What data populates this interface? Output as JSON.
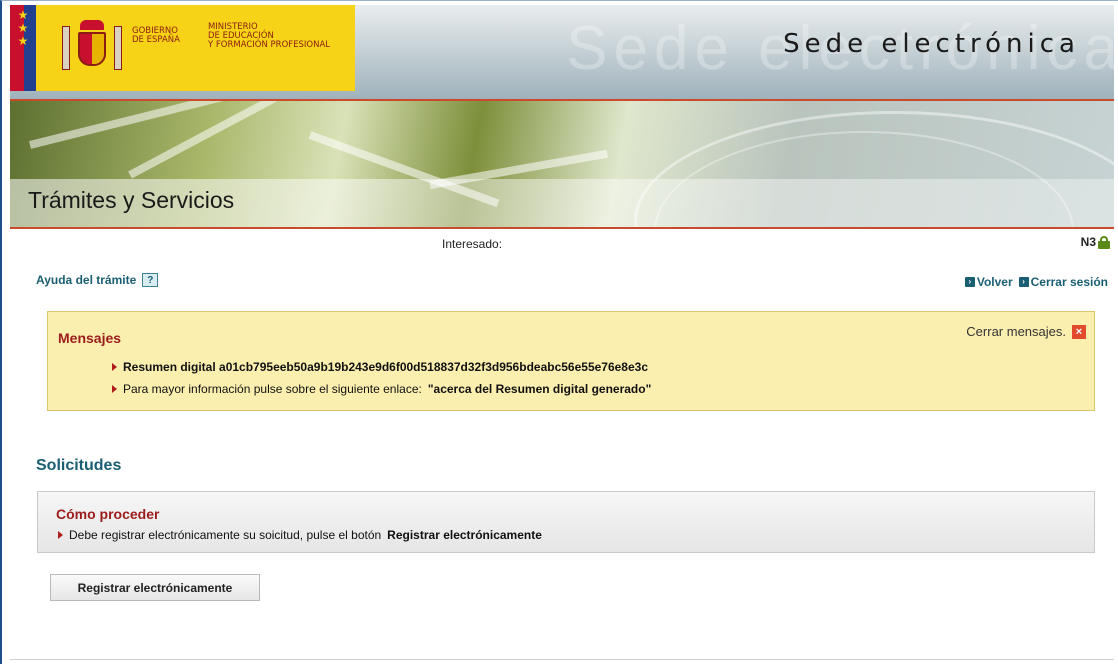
{
  "header": {
    "gov_line1": "GOBIERNO",
    "gov_line2": "DE ESPAÑA",
    "ministry_line1": "MINISTERIO",
    "ministry_line2": "DE EDUCACIÓN",
    "ministry_line3": "Y FORMACIÓN PROFESIONAL",
    "site_title": "Sede electrónica",
    "watermark": "Sede electrónica"
  },
  "banner": {
    "title": "Trámites y Servicios"
  },
  "user": {
    "interesado_label": "Interesado:",
    "level": "N3"
  },
  "links": {
    "help": "Ayuda del trámite",
    "back": "Volver",
    "logout": "Cerrar sesión"
  },
  "messages": {
    "title": "Mensajes",
    "close_label": "Cerrar mensajes.",
    "line1_prefix": "Resumen digital a01cb795eeb50a9b19b243e9d6f00d518837d32f3d956bdeabc56e55e76e8e3c",
    "line2_prefix": "Para mayor información pulse sobre el siguiente enlace:",
    "line2_link": "\"acerca del Resumen digital generado\""
  },
  "solicitudes": {
    "title": "Solicitudes",
    "howto_title": "Cómo proceder",
    "howto_text": "Debe registrar electrónicamente su soicitud, pulse el botón",
    "howto_bold": "Registrar electrónicamente",
    "button_label": "Registrar electrónicamente"
  },
  "colors": {
    "accent": "#1a5e73",
    "alert_red": "#9c1c1c",
    "message_bg": "#fbefb0",
    "header_stripe": "#c94a2d"
  }
}
